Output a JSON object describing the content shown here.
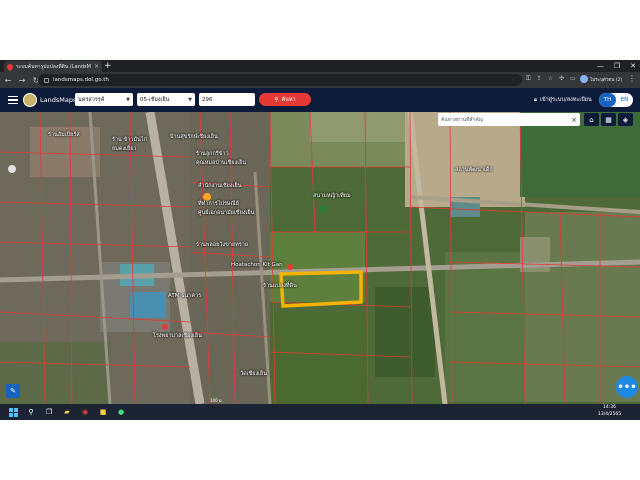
{
  "browser": {
    "tab_title": "ระบบค้นหารูปแปลงที่ดิน (LandsMaps)",
    "tab_close": "×",
    "new_tab": "+",
    "url": "landsmaps.dol.go.th",
    "profile_name": "ไม่ระบุตัวตน (2)",
    "window_controls": [
      "—",
      "❐",
      "✕"
    ]
  },
  "app": {
    "brand": "LandsMaps",
    "province": "นครสวรรค์",
    "district": "05-เชียงเย็น",
    "parcel_no": "296",
    "search_label": "ค้นหา",
    "login_label": "เข้าสู่ระบบ/ลงทะเบียน",
    "lang_th": "TH",
    "lang_en": "EN"
  },
  "map": {
    "place_search_placeholder": "ค้นหาสถานที่สำคัญ",
    "labels": [
      {
        "text": "ร้านฮัมเบียร์ส",
        "name": "place-label"
      },
      {
        "text": "ร้าน ข้าวมันไก่",
        "name": "place-label"
      },
      {
        "text": "ยมดงเยี่ยว",
        "name": "place-label"
      },
      {
        "text": "บ้านสุขรักษ์เชียงเย็น",
        "name": "place-label"
      },
      {
        "text": "ร้านลูกกรี่ข้าว",
        "name": "place-label"
      },
      {
        "text": "คุณหมอบ้านเชียงเย็น",
        "name": "place-label"
      },
      {
        "text": "สำนักงานเชียงเย็น",
        "name": "place-label"
      },
      {
        "text": "ที่ทำการไปรษณีย์",
        "name": "place-label"
      },
      {
        "text": "ศูนย์เอกอนามัยเชียงเย็น",
        "name": "place-label"
      },
      {
        "text": "สนามหญ้าเทียม",
        "name": "place-label"
      },
      {
        "text": "สถานพัฒนาเด็ก",
        "name": "place-label"
      },
      {
        "text": "ร้านพลอยวังขายทราย",
        "name": "place-label"
      },
      {
        "text": "Hoatachon Kit Gan",
        "name": "place-label"
      },
      {
        "text": "ร้านแปลงที่ดิน",
        "name": "place-label"
      },
      {
        "text": "ATM ธนาคาร",
        "name": "place-label"
      },
      {
        "text": "โรงพยาบาลเชียงเย็น",
        "name": "place-label"
      },
      {
        "text": "วัดเชียงเย็น",
        "name": "place-label"
      }
    ],
    "scale_label": "100 ม."
  },
  "taskbar": {
    "time": "14:36",
    "date": "13/4/2565"
  }
}
